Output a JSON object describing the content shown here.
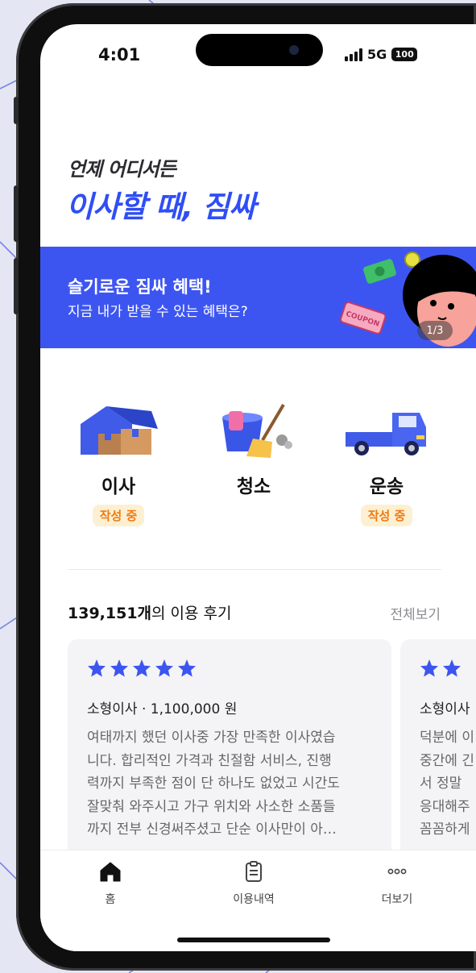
{
  "status_bar": {
    "time": "4:01",
    "network": "5G",
    "battery": "100"
  },
  "hero": {
    "subtitle": "언제 어디서든",
    "title": "이사할 때, 짐싸"
  },
  "banner": {
    "title": "슬기로운 짐싸 혜택!",
    "subtitle": "지금 내가 받을 수 있는 혜택은?",
    "pager": "1/3",
    "coupon_text": "COUPON",
    "color": "#3d55f0"
  },
  "services": [
    {
      "label": "이사",
      "badge": "작성 중",
      "icon": "house-boxes-icon"
    },
    {
      "label": "청소",
      "badge": "",
      "icon": "bucket-broom-icon"
    },
    {
      "label": "운송",
      "badge": "작성 중",
      "icon": "truck-icon"
    }
  ],
  "reviews": {
    "count": "139,151개",
    "count_suffix": "의 이용 후기",
    "view_all": "전체보기",
    "items": [
      {
        "stars": 5,
        "meta": "소형이사 · 1,100,000 원",
        "body_lines": [
          "여태까지 했던 이사중 가장 만족한 이사였습",
          "니다. 합리적인 가격과 친절함 서비스, 진행",
          "력까지 부족한 점이 단 하나도 없었고 시간도",
          "잘맞춰 와주시고 가구 위치와 사소한 소품들",
          "까지 전부 신경써주셨고 단순 이사만이 아…"
        ]
      },
      {
        "stars": 2,
        "meta": "소형이사",
        "body_lines": [
          "덕분에 이",
          "중간에 긴",
          "서 정말",
          "응대해주",
          "꼼꼼하게"
        ]
      }
    ]
  },
  "tabbar": [
    {
      "label": "홈",
      "icon": "home-icon"
    },
    {
      "label": "이용내역",
      "icon": "clipboard-icon"
    },
    {
      "label": "더보기",
      "icon": "more-dots-icon"
    }
  ],
  "colors": {
    "accent": "#2f4ef5",
    "badge_text": "#f07a10",
    "badge_bg": "#fdf0d2",
    "star": "#3d55f0"
  }
}
